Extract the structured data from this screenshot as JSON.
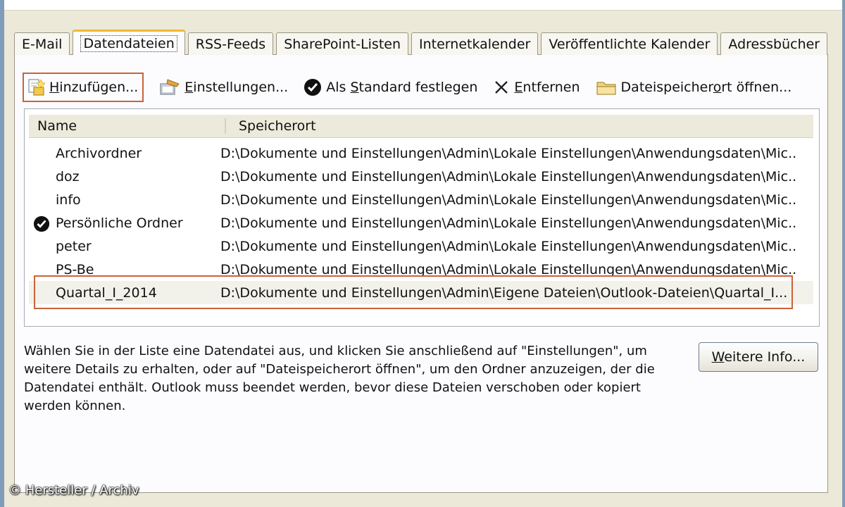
{
  "tabs": [
    {
      "label": "E-Mail",
      "active": false
    },
    {
      "label": "Datendateien",
      "active": true
    },
    {
      "label": "RSS-Feeds",
      "active": false
    },
    {
      "label": "SharePoint-Listen",
      "active": false
    },
    {
      "label": "Internetkalender",
      "active": false
    },
    {
      "label": "Veröffentlichte Kalender",
      "active": false
    },
    {
      "label": "Adressbücher",
      "active": false
    }
  ],
  "toolbar": {
    "add": {
      "accel": "H",
      "rest": "inzufügen...",
      "icon": "add-datafile-icon"
    },
    "settings": {
      "accel": "E",
      "rest": "instellungen...",
      "icon": "settings-icon"
    },
    "default": {
      "pre": "Als ",
      "accel": "S",
      "rest": "tandard festlegen",
      "icon": "checkmark-icon"
    },
    "remove": {
      "accel": "E",
      "rest": "ntfernen",
      "icon": "x-icon"
    },
    "open": {
      "pre": "Dateispeicher",
      "accel": "o",
      "rest": "rt öffnen...",
      "icon": "folder-icon"
    }
  },
  "list": {
    "headers": {
      "name": "Name",
      "location": "Speicherort"
    },
    "rows": [
      {
        "name": "Archivordner",
        "location": "D:\\Dokumente und Einstellungen\\Admin\\Lokale Einstellungen\\Anwendungsdaten\\Mic...",
        "default": false,
        "selected": false
      },
      {
        "name": "doz",
        "location": "D:\\Dokumente und Einstellungen\\Admin\\Lokale Einstellungen\\Anwendungsdaten\\Mic...",
        "default": false,
        "selected": false
      },
      {
        "name": "info",
        "location": "D:\\Dokumente und Einstellungen\\Admin\\Lokale Einstellungen\\Anwendungsdaten\\Mic...",
        "default": false,
        "selected": false
      },
      {
        "name": "Persönliche Ordner",
        "location": "D:\\Dokumente und Einstellungen\\Admin\\Lokale Einstellungen\\Anwendungsdaten\\Mic...",
        "default": true,
        "selected": false
      },
      {
        "name": "peter",
        "location": "D:\\Dokumente und Einstellungen\\Admin\\Lokale Einstellungen\\Anwendungsdaten\\Mic...",
        "default": false,
        "selected": false
      },
      {
        "name": "PS-Be",
        "location": "D:\\Dokumente und Einstellungen\\Admin\\Lokale Einstellungen\\Anwendungsdaten\\Mic...",
        "default": false,
        "selected": false
      },
      {
        "name": "Quartal_I_2014",
        "location": "D:\\Dokumente und Einstellungen\\Admin\\Eigene Dateien\\Outlook-Dateien\\Quartal_I...",
        "default": false,
        "selected": true
      }
    ]
  },
  "description": "Wählen Sie in der Liste eine Datendatei aus, und klicken Sie anschließend auf \"Einstellungen\", um weitere Details zu erhalten, oder auf \"Dateispeicherort öffnen\", um den Ordner anzuzeigen, der die Datendatei enthält. Outlook muss beendet werden, bevor diese Dateien verschoben oder kopiert werden können.",
  "more_info": {
    "accel": "W",
    "rest": "eitere Info..."
  },
  "credit": "© Hersteller / Archiv",
  "colors": {
    "highlight": "#c9633a",
    "tab_accent": "#f0b838",
    "dialog_bg": "#ece9d8"
  }
}
